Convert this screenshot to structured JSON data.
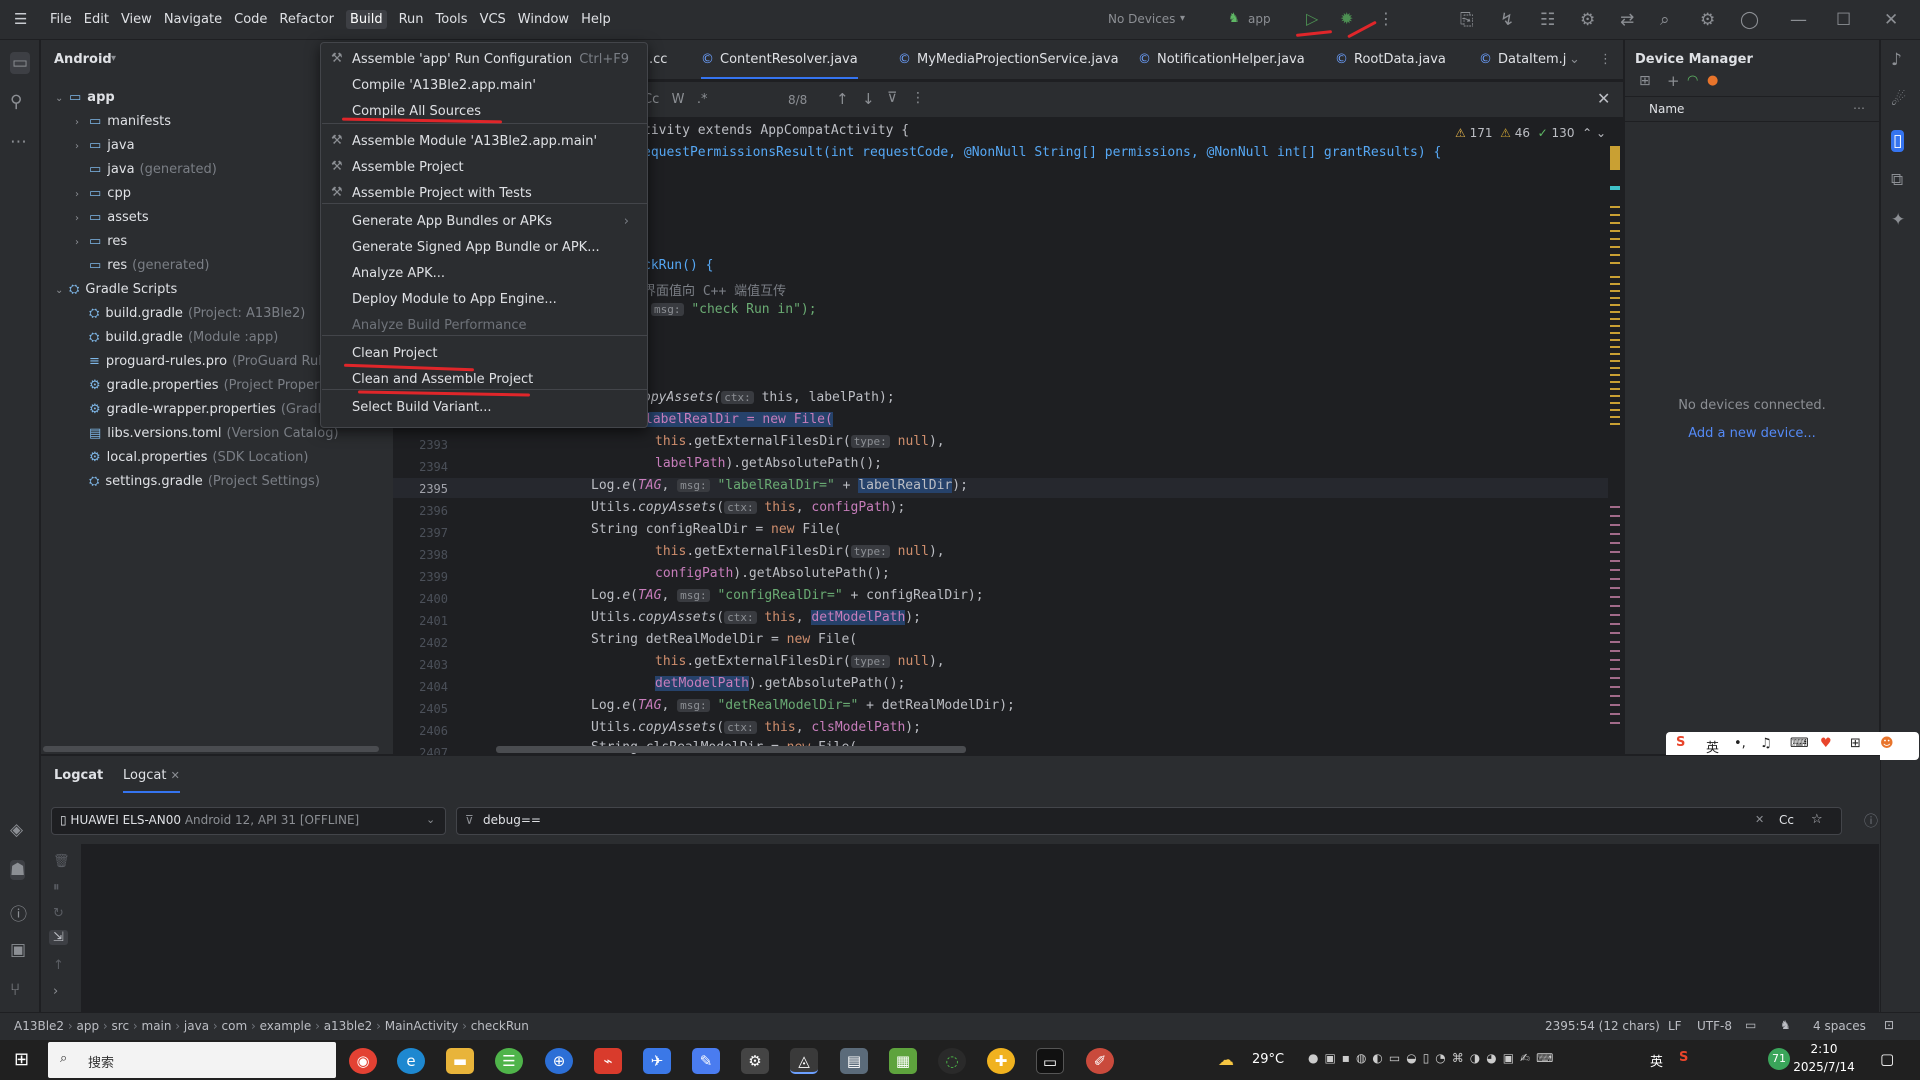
{
  "menubar": {
    "items": [
      "File",
      "Edit",
      "View",
      "Navigate",
      "Code",
      "Refactor",
      "Build",
      "Run",
      "Tools",
      "VCS",
      "Window",
      "Help"
    ]
  },
  "toolbar": {
    "devices": "No Devices",
    "config": "app"
  },
  "project_panel": {
    "title": "Android",
    "tree": [
      {
        "label": "app",
        "hint": "",
        "type": "folder",
        "depth": 0,
        "arrow": "open"
      },
      {
        "label": "manifests",
        "hint": "",
        "type": "folder",
        "depth": 1,
        "arrow": "closed"
      },
      {
        "label": "java",
        "hint": "",
        "type": "folder",
        "depth": 1,
        "arrow": "closed"
      },
      {
        "label": "java",
        "hint": "(generated)",
        "type": "folder",
        "depth": 1,
        "arrow": "none"
      },
      {
        "label": "cpp",
        "hint": "",
        "type": "folder",
        "depth": 1,
        "arrow": "closed"
      },
      {
        "label": "assets",
        "hint": "",
        "type": "folder",
        "depth": 1,
        "arrow": "closed"
      },
      {
        "label": "res",
        "hint": "",
        "type": "folder",
        "depth": 1,
        "arrow": "closed"
      },
      {
        "label": "res",
        "hint": "(generated)",
        "type": "folder",
        "depth": 1,
        "arrow": "none"
      },
      {
        "label": "Gradle Scripts",
        "hint": "",
        "type": "gradle",
        "depth": 0,
        "arrow": "open"
      },
      {
        "label": "build.gradle",
        "hint": "(Project: A13Ble2)",
        "type": "gradle",
        "depth": 1,
        "arrow": "none"
      },
      {
        "label": "build.gradle",
        "hint": "(Module :app)",
        "type": "gradle",
        "depth": 1,
        "arrow": "none"
      },
      {
        "label": "proguard-rules.pro",
        "hint": "(ProGuard Rule",
        "type": "file",
        "depth": 1,
        "arrow": "none"
      },
      {
        "label": "gradle.properties",
        "hint": "(Project Properti",
        "type": "gear",
        "depth": 1,
        "arrow": "none"
      },
      {
        "label": "gradle-wrapper.properties",
        "hint": "(Gradle",
        "type": "gear",
        "depth": 1,
        "arrow": "none"
      },
      {
        "label": "libs.versions.toml",
        "hint": "(Version Catalog)",
        "type": "toml",
        "depth": 1,
        "arrow": "none"
      },
      {
        "label": "local.properties",
        "hint": "(SDK Location)",
        "type": "gear",
        "depth": 1,
        "arrow": "none"
      },
      {
        "label": "settings.gradle",
        "hint": "(Project Settings)",
        "type": "gradle",
        "depth": 1,
        "arrow": "none"
      }
    ]
  },
  "tabs": [
    ".cc",
    "ContentResolver.java",
    "MyMediaProjectionService.java",
    "NotificationHelper.java",
    "RootData.java",
    "DataItem.j"
  ],
  "findbar": {
    "opts": [
      "Cc",
      "W",
      ".*"
    ],
    "count": "8/8"
  },
  "inspections": {
    "warnings": "171",
    "weak": "46",
    "ok": "130"
  },
  "build_menu": {
    "items": [
      {
        "label": "Assemble 'app' Run Configuration",
        "shortcut": "Ctrl+F9",
        "icon": "hammer"
      },
      {
        "label": "Compile 'A13Ble2.app.main'",
        "shortcut": "",
        "icon": ""
      },
      {
        "label": "Compile All Sources",
        "shortcut": "",
        "icon": ""
      },
      {
        "label": "Assemble Module 'A13Ble2.app.main'",
        "shortcut": "",
        "icon": "hammer"
      },
      {
        "label": "Assemble Project",
        "shortcut": "",
        "icon": "hammer"
      },
      {
        "label": "Assemble Project with Tests",
        "shortcut": "",
        "icon": "hammer"
      },
      {
        "label": "Generate App Bundles or APKs",
        "shortcut": "",
        "icon": "",
        "submenu": true
      },
      {
        "label": "Generate Signed App Bundle or APK...",
        "shortcut": "",
        "icon": ""
      },
      {
        "label": "Analyze APK...",
        "shortcut": "",
        "icon": ""
      },
      {
        "label": "Deploy Module to App Engine...",
        "shortcut": "",
        "icon": ""
      },
      {
        "label": "Analyze Build Performance",
        "shortcut": "",
        "icon": "",
        "disabled": true
      },
      {
        "label": "Clean Project",
        "shortcut": "",
        "icon": ""
      },
      {
        "label": "Clean and Assemble Project",
        "shortcut": "",
        "icon": ""
      },
      {
        "label": "Select Build Variant...",
        "shortcut": "",
        "icon": ""
      }
    ]
  },
  "code": {
    "line_numbers": [
      "2393",
      "2394",
      "2395",
      "2396",
      "2397",
      "2398",
      "2399",
      "2400",
      "2401",
      "2402",
      "2403",
      "2404",
      "2405",
      "2406",
      "2407"
    ],
    "top_lines": [
      "tivity extends AppCompatActivity {",
      "equestPermissionsResult(int requestCode, @NonNull String[] permissions, @NonNull int[] grantResults) {",
      "ckRun() {",
      "界面值向 C++ 端值互传",
      "msg:",
      "\"check Run in\");",
      "opyAssets(",
      "ctx:",
      "this, labelPath);",
      "labelRealDir = new File("
    ]
  },
  "device_manager": {
    "title": "Device Manager",
    "col": "Name",
    "empty": "No devices connected.",
    "link": "Add a new device..."
  },
  "logcat": {
    "tabs": [
      "Logcat",
      "Logcat"
    ],
    "device": "HUAWEI ELS-AN00",
    "device_info": "Android 12, API 31 [OFFLINE]",
    "filter": "debug==",
    "cc": "Cc"
  },
  "breadcrumb": [
    "A13Ble2",
    "app",
    "src",
    "main",
    "java",
    "com",
    "example",
    "a13ble2",
    "MainActivity",
    "checkRun"
  ],
  "status": {
    "pos": "2395:54 (12 chars)",
    "lf": "LF",
    "enc": "UTF-8",
    "indent": "4 spaces"
  },
  "taskbar": {
    "search": "搜索",
    "weather": "29°C",
    "time": "2:10",
    "date": "2025/7/14",
    "ime_lang": "英",
    "badge": "71"
  },
  "colors": {
    "accent": "#3574f0",
    "annotation_red": "#e0262a",
    "bg": "#1e1f22",
    "panel": "#2b2d30"
  }
}
